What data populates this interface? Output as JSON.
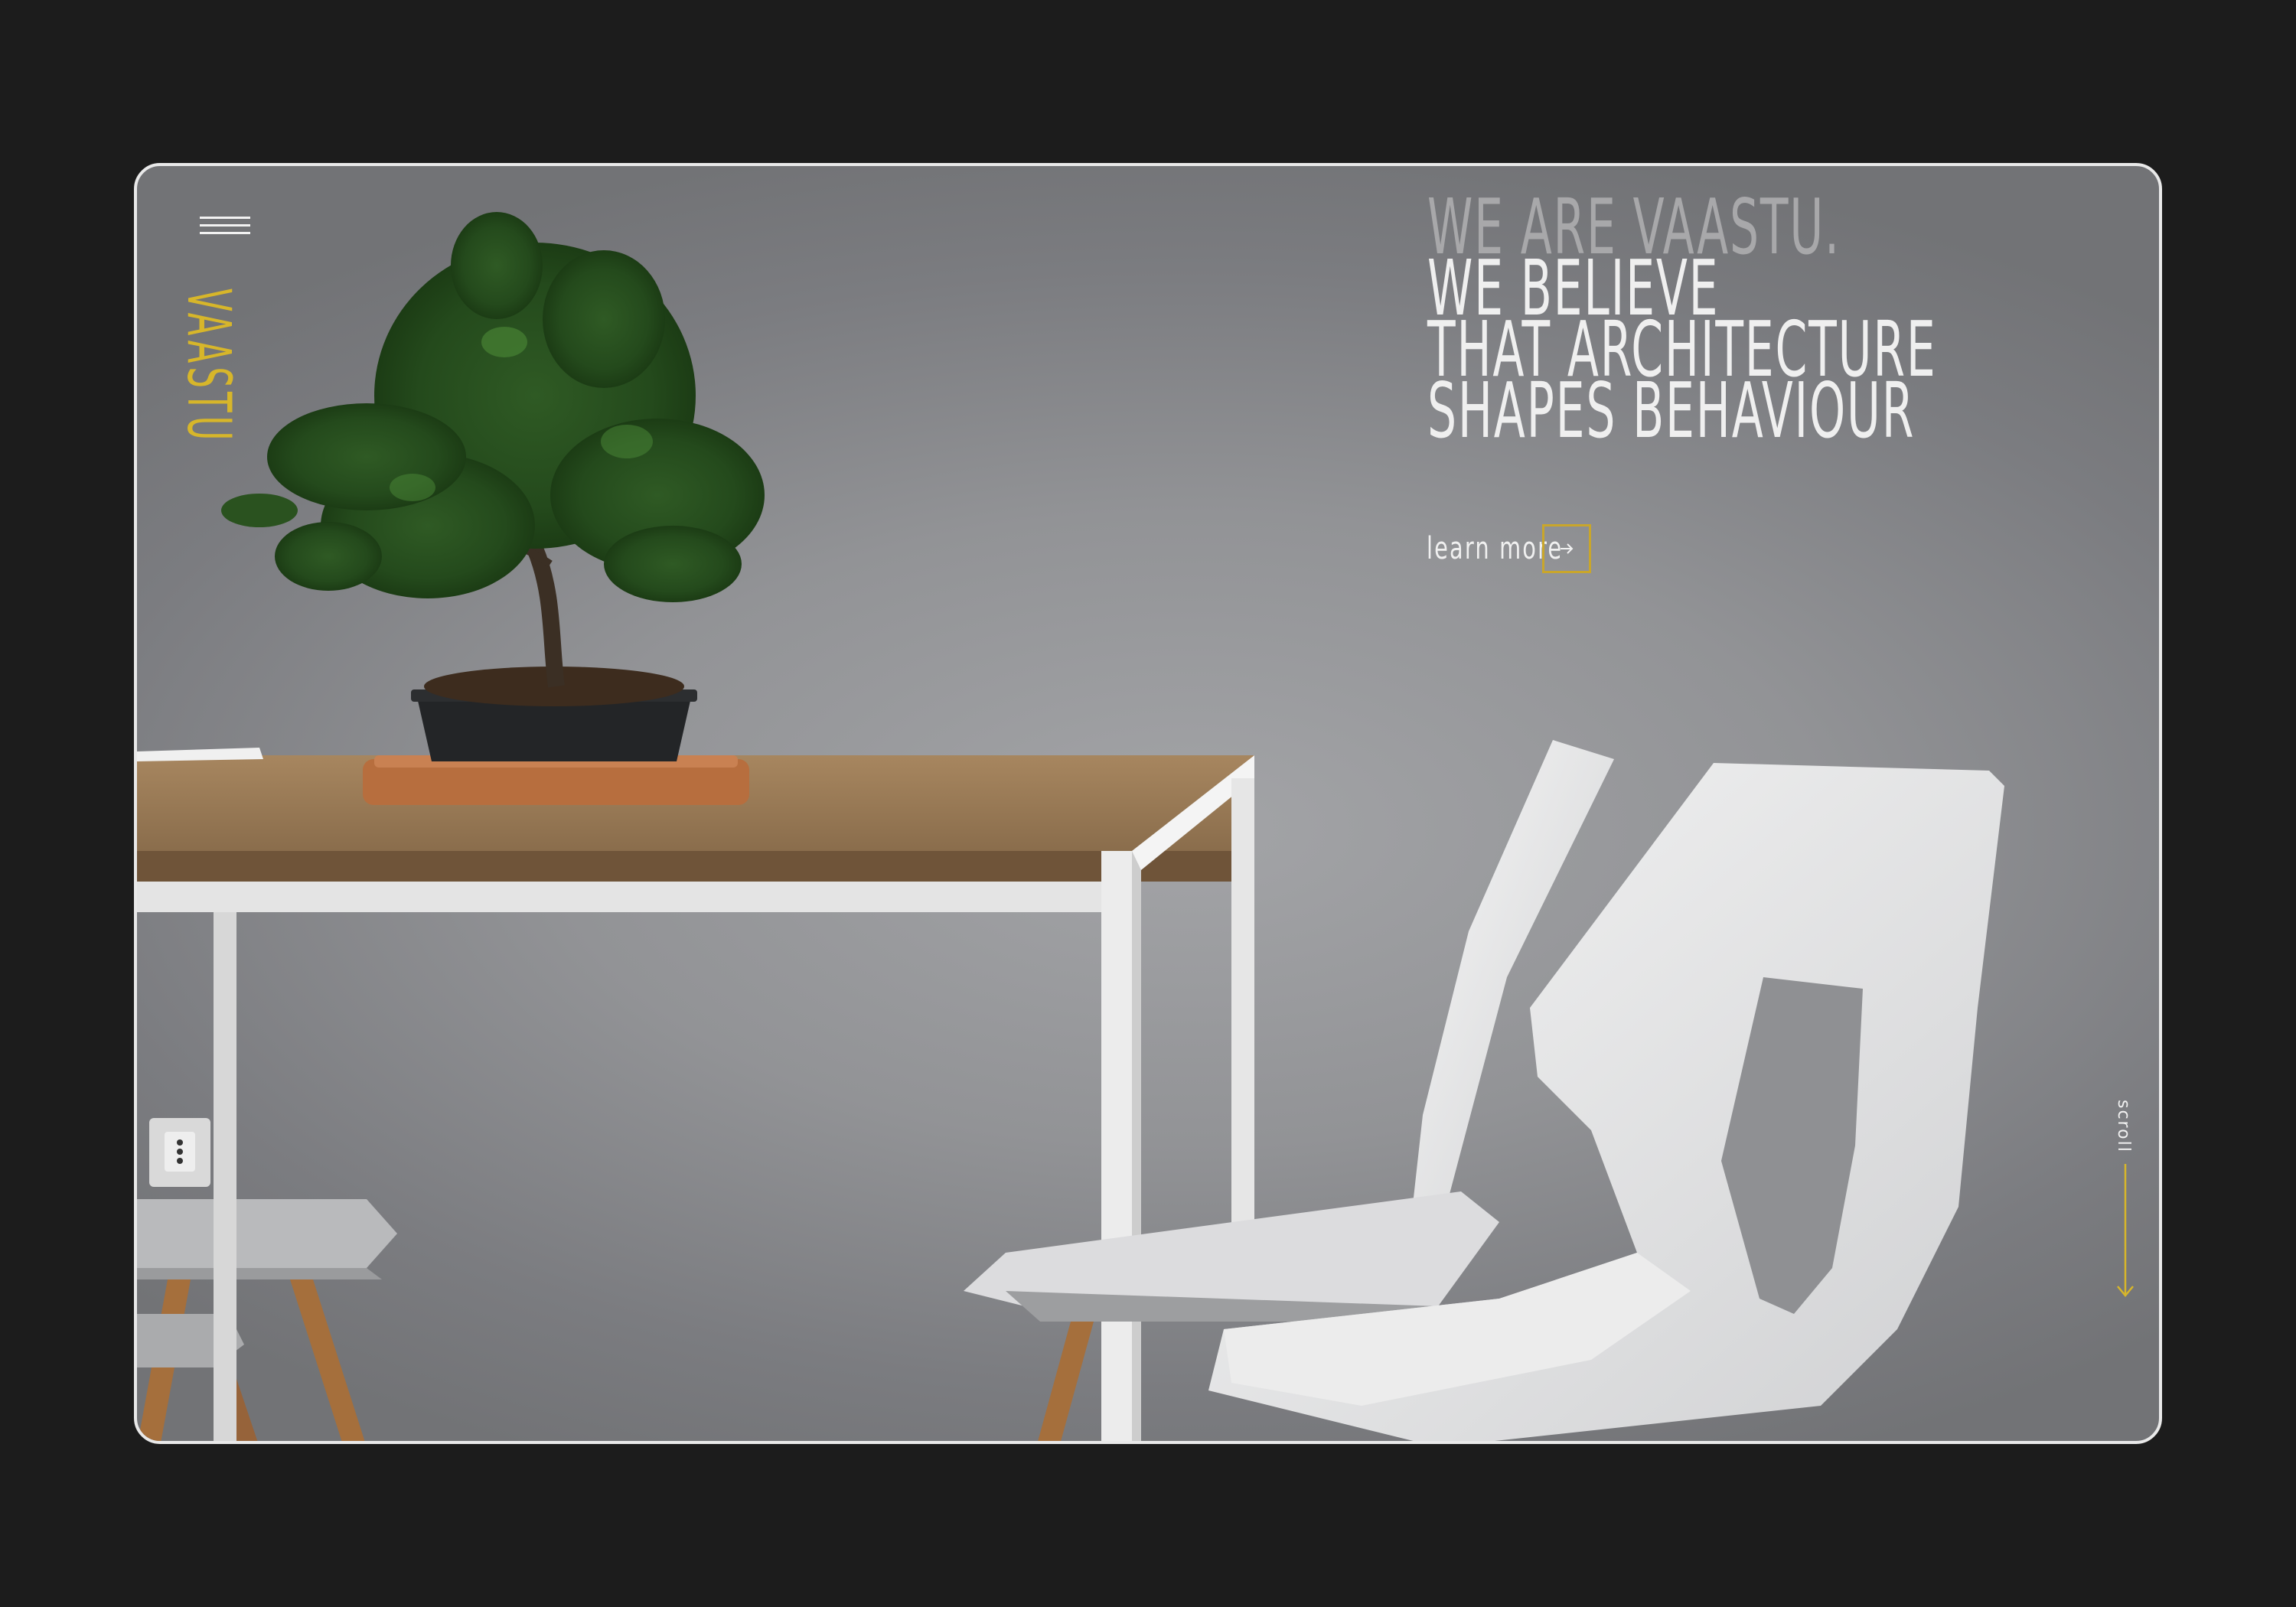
{
  "brand": {
    "name": "VAASTU"
  },
  "hero": {
    "headline_muted": "WE ARE VAASTU.",
    "headline_lines": [
      "WE BELIEVE",
      "THAT ARCHITECTURE",
      "SHAPES BEHAVIOUR"
    ],
    "cta_label": "learn more",
    "cta_icon": "arrow-right-icon"
  },
  "menu": {
    "icon": "hamburger-menu-icon"
  },
  "scroll": {
    "label": "scroll",
    "icon": "arrow-down-icon"
  },
  "colors": {
    "accent": "#d7b62a",
    "background": "#1c1c1c",
    "wall": "#929396",
    "text_light": "#efefef",
    "text_muted": "#a8a8aa"
  }
}
